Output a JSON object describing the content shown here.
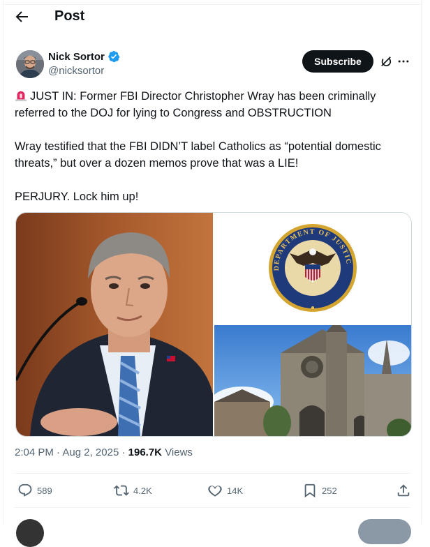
{
  "header": {
    "title": "Post"
  },
  "author": {
    "name": "Nick Sortor",
    "handle": "@nicksortor"
  },
  "actions_top": {
    "subscribe_label": "Subscribe"
  },
  "tweet": {
    "paragraphs": [
      "JUST IN: Former FBI Director Christopher Wray has been criminally referred to the DOJ for lying to Congress and OBSTRUCTION",
      "Wray testified that the FBI DIDN’T label Catholics as “potential domestic threats,” but over a dozen memos prove that was a LIE!",
      "PERJURY. Lock him up!"
    ]
  },
  "meta": {
    "time": "2:04 PM",
    "separator": "·",
    "date": "Aug 2, 2025",
    "views_count": "196.7K",
    "views_label": "Views"
  },
  "stats": {
    "replies": "589",
    "reposts": "4.2K",
    "likes": "14K",
    "bookmarks": "252"
  },
  "colors": {
    "accent": "#1d9bf0",
    "text": "#0f1419",
    "muted": "#536471",
    "button_dark": "#0f1419",
    "siren": "#e0245e"
  },
  "icons": [
    "back-arrow-icon",
    "verified-badge-icon",
    "grok-icon",
    "more-icon",
    "siren-emoji-icon",
    "reply-icon",
    "repost-icon",
    "like-icon",
    "bookmark-icon",
    "share-icon"
  ],
  "media": {
    "seal_text": "DEPARTMENT OF JUSTICE"
  }
}
